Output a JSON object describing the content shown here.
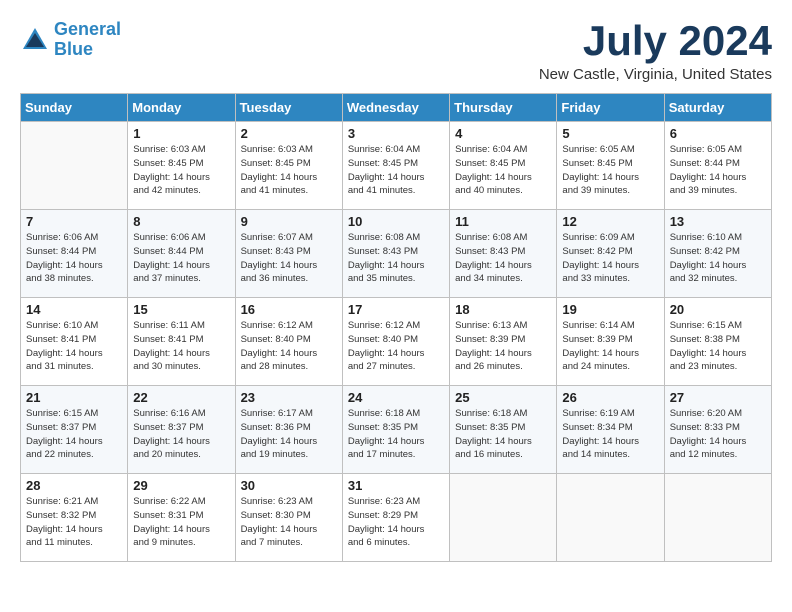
{
  "header": {
    "logo_line1": "General",
    "logo_line2": "Blue",
    "month_year": "July 2024",
    "location": "New Castle, Virginia, United States"
  },
  "days_of_week": [
    "Sunday",
    "Monday",
    "Tuesday",
    "Wednesday",
    "Thursday",
    "Friday",
    "Saturday"
  ],
  "weeks": [
    [
      {
        "day": "",
        "info": ""
      },
      {
        "day": "1",
        "info": "Sunrise: 6:03 AM\nSunset: 8:45 PM\nDaylight: 14 hours\nand 42 minutes."
      },
      {
        "day": "2",
        "info": "Sunrise: 6:03 AM\nSunset: 8:45 PM\nDaylight: 14 hours\nand 41 minutes."
      },
      {
        "day": "3",
        "info": "Sunrise: 6:04 AM\nSunset: 8:45 PM\nDaylight: 14 hours\nand 41 minutes."
      },
      {
        "day": "4",
        "info": "Sunrise: 6:04 AM\nSunset: 8:45 PM\nDaylight: 14 hours\nand 40 minutes."
      },
      {
        "day": "5",
        "info": "Sunrise: 6:05 AM\nSunset: 8:45 PM\nDaylight: 14 hours\nand 39 minutes."
      },
      {
        "day": "6",
        "info": "Sunrise: 6:05 AM\nSunset: 8:44 PM\nDaylight: 14 hours\nand 39 minutes."
      }
    ],
    [
      {
        "day": "7",
        "info": "Sunrise: 6:06 AM\nSunset: 8:44 PM\nDaylight: 14 hours\nand 38 minutes."
      },
      {
        "day": "8",
        "info": "Sunrise: 6:06 AM\nSunset: 8:44 PM\nDaylight: 14 hours\nand 37 minutes."
      },
      {
        "day": "9",
        "info": "Sunrise: 6:07 AM\nSunset: 8:43 PM\nDaylight: 14 hours\nand 36 minutes."
      },
      {
        "day": "10",
        "info": "Sunrise: 6:08 AM\nSunset: 8:43 PM\nDaylight: 14 hours\nand 35 minutes."
      },
      {
        "day": "11",
        "info": "Sunrise: 6:08 AM\nSunset: 8:43 PM\nDaylight: 14 hours\nand 34 minutes."
      },
      {
        "day": "12",
        "info": "Sunrise: 6:09 AM\nSunset: 8:42 PM\nDaylight: 14 hours\nand 33 minutes."
      },
      {
        "day": "13",
        "info": "Sunrise: 6:10 AM\nSunset: 8:42 PM\nDaylight: 14 hours\nand 32 minutes."
      }
    ],
    [
      {
        "day": "14",
        "info": "Sunrise: 6:10 AM\nSunset: 8:41 PM\nDaylight: 14 hours\nand 31 minutes."
      },
      {
        "day": "15",
        "info": "Sunrise: 6:11 AM\nSunset: 8:41 PM\nDaylight: 14 hours\nand 30 minutes."
      },
      {
        "day": "16",
        "info": "Sunrise: 6:12 AM\nSunset: 8:40 PM\nDaylight: 14 hours\nand 28 minutes."
      },
      {
        "day": "17",
        "info": "Sunrise: 6:12 AM\nSunset: 8:40 PM\nDaylight: 14 hours\nand 27 minutes."
      },
      {
        "day": "18",
        "info": "Sunrise: 6:13 AM\nSunset: 8:39 PM\nDaylight: 14 hours\nand 26 minutes."
      },
      {
        "day": "19",
        "info": "Sunrise: 6:14 AM\nSunset: 8:39 PM\nDaylight: 14 hours\nand 24 minutes."
      },
      {
        "day": "20",
        "info": "Sunrise: 6:15 AM\nSunset: 8:38 PM\nDaylight: 14 hours\nand 23 minutes."
      }
    ],
    [
      {
        "day": "21",
        "info": "Sunrise: 6:15 AM\nSunset: 8:37 PM\nDaylight: 14 hours\nand 22 minutes."
      },
      {
        "day": "22",
        "info": "Sunrise: 6:16 AM\nSunset: 8:37 PM\nDaylight: 14 hours\nand 20 minutes."
      },
      {
        "day": "23",
        "info": "Sunrise: 6:17 AM\nSunset: 8:36 PM\nDaylight: 14 hours\nand 19 minutes."
      },
      {
        "day": "24",
        "info": "Sunrise: 6:18 AM\nSunset: 8:35 PM\nDaylight: 14 hours\nand 17 minutes."
      },
      {
        "day": "25",
        "info": "Sunrise: 6:18 AM\nSunset: 8:35 PM\nDaylight: 14 hours\nand 16 minutes."
      },
      {
        "day": "26",
        "info": "Sunrise: 6:19 AM\nSunset: 8:34 PM\nDaylight: 14 hours\nand 14 minutes."
      },
      {
        "day": "27",
        "info": "Sunrise: 6:20 AM\nSunset: 8:33 PM\nDaylight: 14 hours\nand 12 minutes."
      }
    ],
    [
      {
        "day": "28",
        "info": "Sunrise: 6:21 AM\nSunset: 8:32 PM\nDaylight: 14 hours\nand 11 minutes."
      },
      {
        "day": "29",
        "info": "Sunrise: 6:22 AM\nSunset: 8:31 PM\nDaylight: 14 hours\nand 9 minutes."
      },
      {
        "day": "30",
        "info": "Sunrise: 6:23 AM\nSunset: 8:30 PM\nDaylight: 14 hours\nand 7 minutes."
      },
      {
        "day": "31",
        "info": "Sunrise: 6:23 AM\nSunset: 8:29 PM\nDaylight: 14 hours\nand 6 minutes."
      },
      {
        "day": "",
        "info": ""
      },
      {
        "day": "",
        "info": ""
      },
      {
        "day": "",
        "info": ""
      }
    ]
  ]
}
